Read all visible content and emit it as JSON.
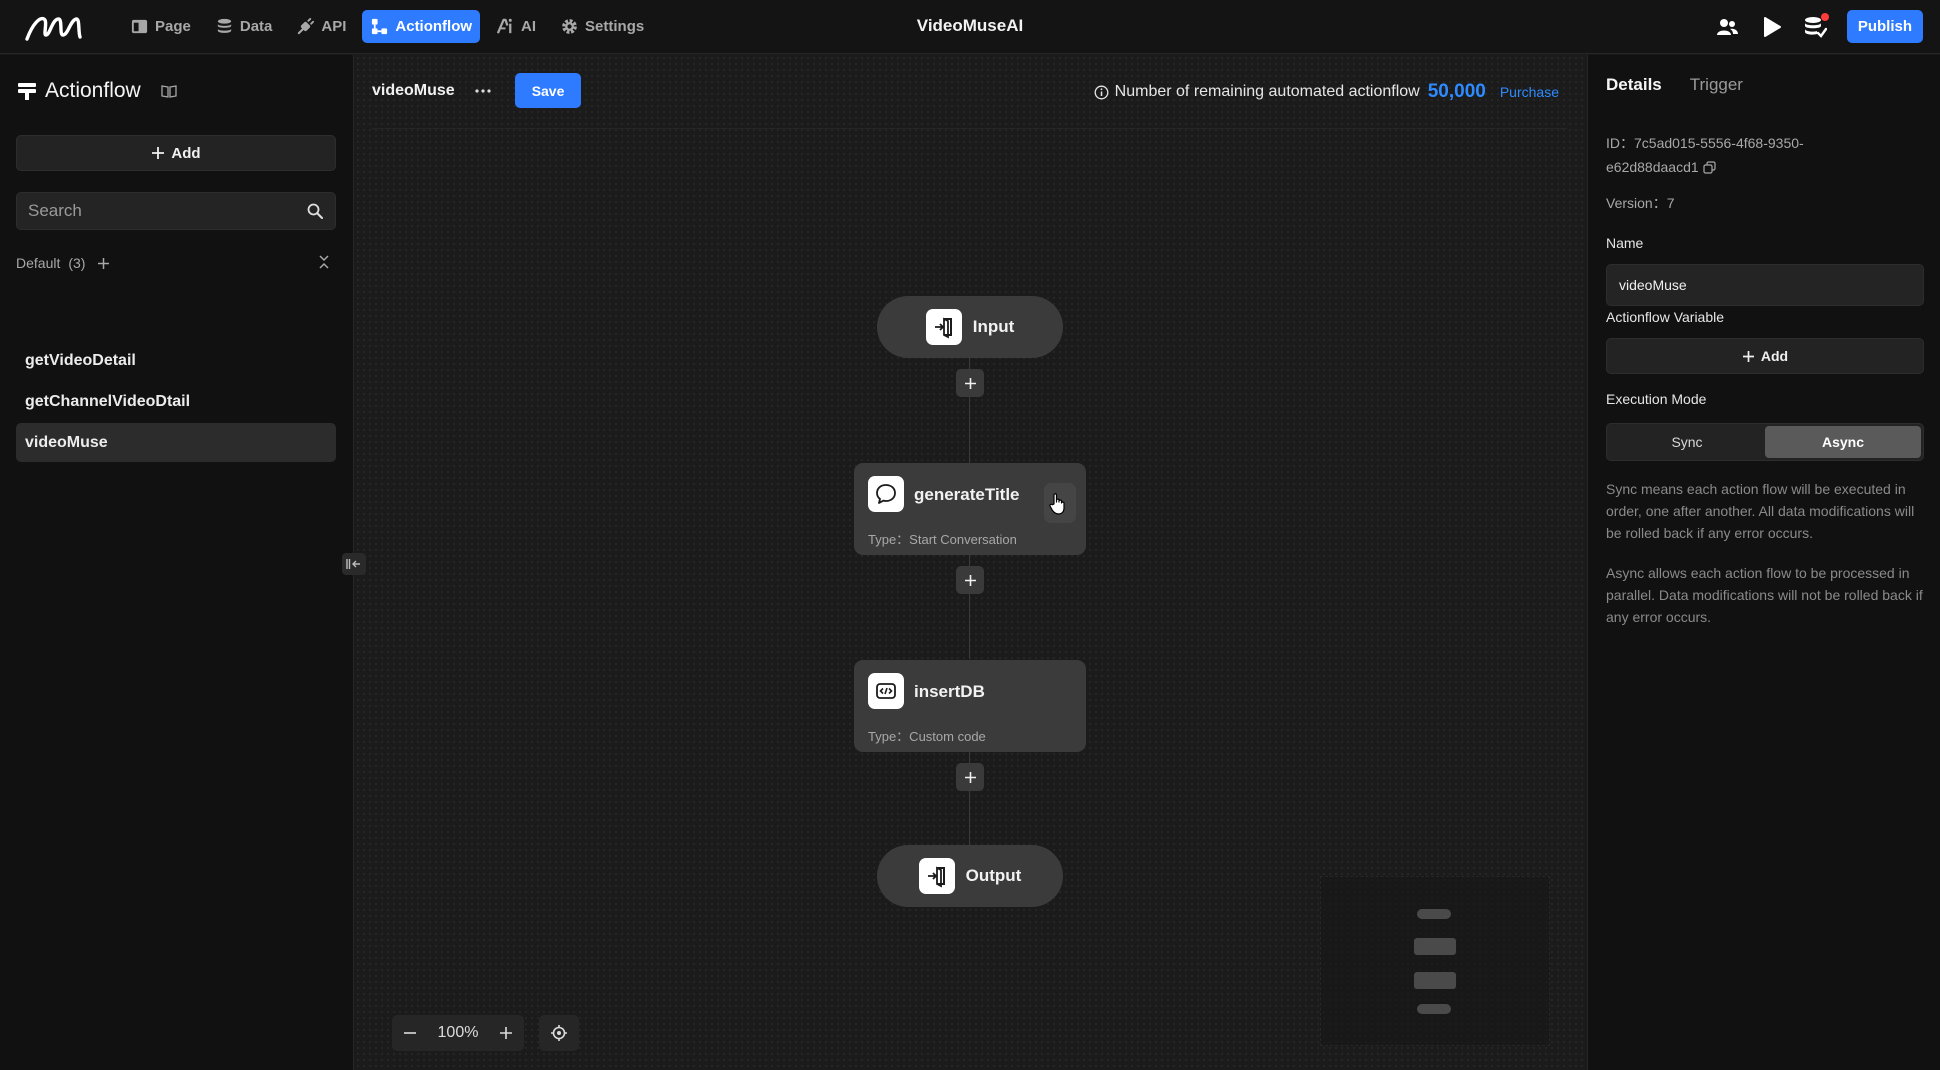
{
  "app": {
    "title": "VideoMuseAI"
  },
  "nav": [
    {
      "key": "page",
      "label": "Page"
    },
    {
      "key": "data",
      "label": "Data"
    },
    {
      "key": "api",
      "label": "API"
    },
    {
      "key": "actionflow",
      "label": "Actionflow"
    },
    {
      "key": "ai",
      "label": "AI"
    },
    {
      "key": "settings",
      "label": "Settings"
    }
  ],
  "header": {
    "publish_label": "Publish"
  },
  "sidebar": {
    "title": "Actionflow",
    "add_label": "Add",
    "search_placeholder": "Search",
    "group": {
      "name": "Default",
      "count": "(3)"
    },
    "items": [
      {
        "label": "getVideoDetail"
      },
      {
        "label": "getChannelVideoDtail"
      },
      {
        "label": "videoMuse"
      }
    ]
  },
  "canvas": {
    "flow_name": "videoMuse",
    "save_label": "Save",
    "remaining_text": "Number of remaining automated actionflow",
    "remaining_count": "50,000",
    "purchase_label": "Purchase",
    "zoom": "100%",
    "nodes": {
      "input": {
        "name": "Input"
      },
      "generate_title": {
        "name": "generateTitle",
        "type": "Type：Start Conversation"
      },
      "insert_db": {
        "name": "insertDB",
        "type": "Type：Custom code"
      },
      "output": {
        "name": "Output"
      }
    }
  },
  "panel": {
    "tabs": [
      {
        "label": "Details"
      },
      {
        "label": "Trigger"
      }
    ],
    "id_line1": "ID：7c5ad015-5556-4f68-9350-",
    "id_line2": "e62d88daacd1",
    "version": "Version：7",
    "name_label": "Name",
    "name_value": "videoMuse",
    "variable_label": "Actionflow Variable",
    "variable_add_label": "Add",
    "mode_label": "Execution Mode",
    "modes": [
      {
        "label": "Sync"
      },
      {
        "label": "Async"
      }
    ],
    "sync_desc": "Sync means each action flow will be executed in order, one after another. All data modifications will be rolled back if any error occurs.",
    "async_desc": "Async allows each action flow to be processed in parallel. Data modifications will not be rolled back if any error occurs."
  },
  "colors": {
    "accent": "#2e7bff",
    "highlight": "#2e8bff",
    "background": "#1a1a1a",
    "node": "#3b3b3b"
  }
}
